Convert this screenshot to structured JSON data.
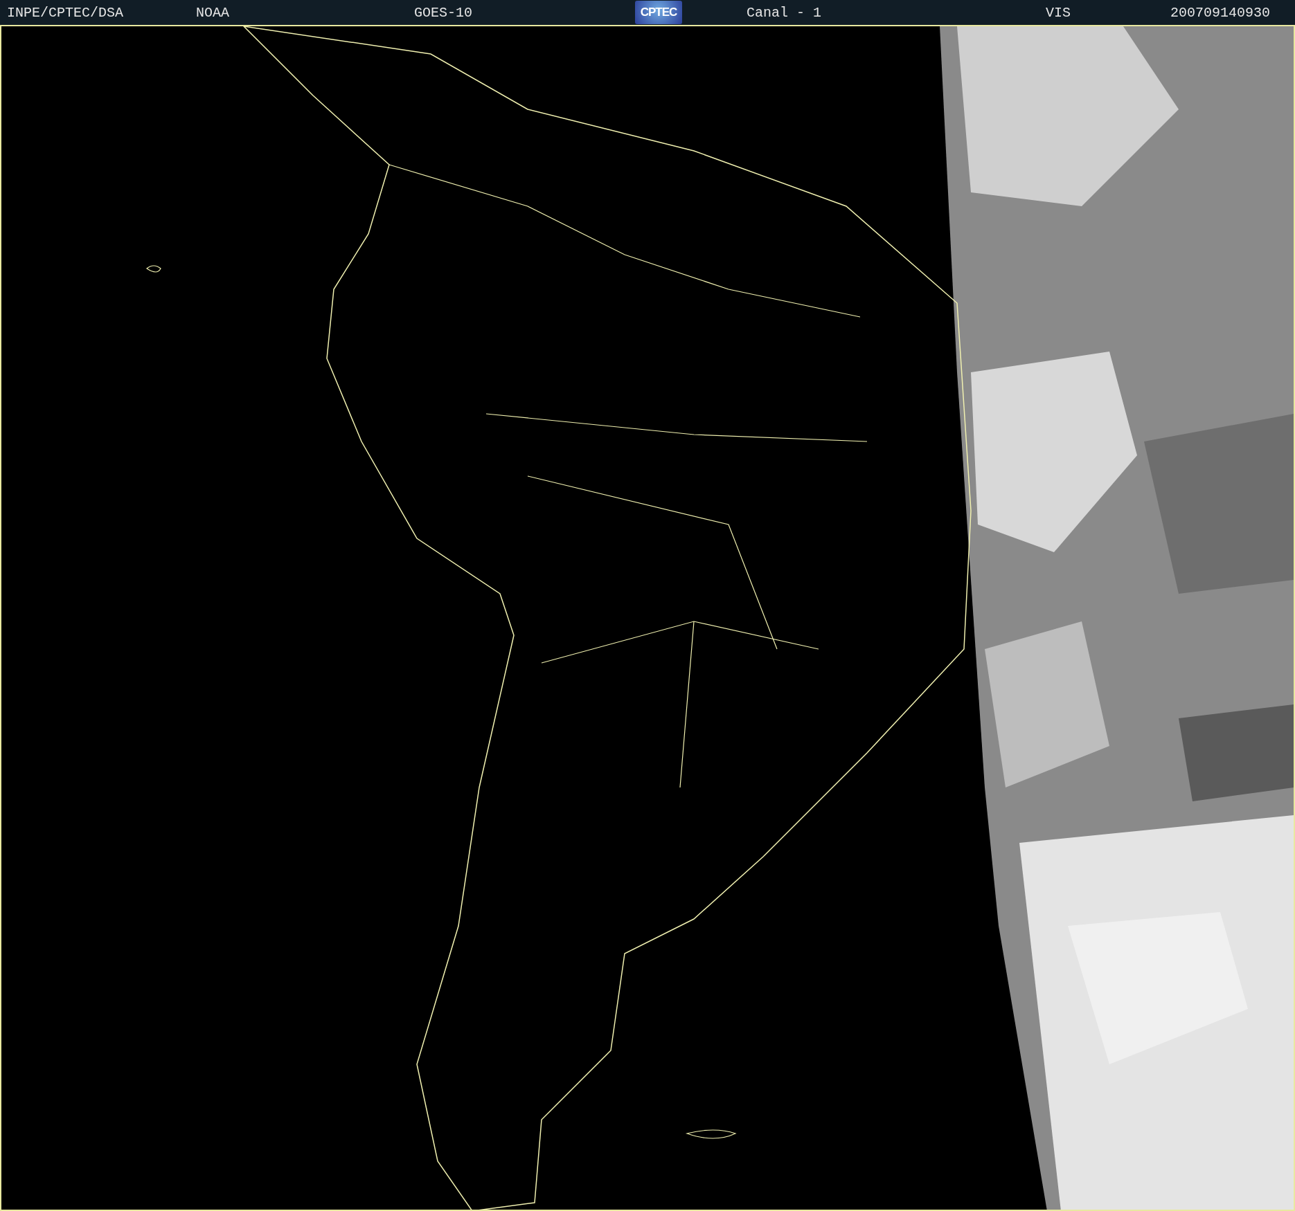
{
  "header": {
    "agency": "INPE/CPTEC/DSA",
    "source": "NOAA",
    "satellite": "GOES-10",
    "logo": "CPTEC",
    "channel": "Canal - 1",
    "band": "VIS",
    "timestamp": "200709140930"
  }
}
